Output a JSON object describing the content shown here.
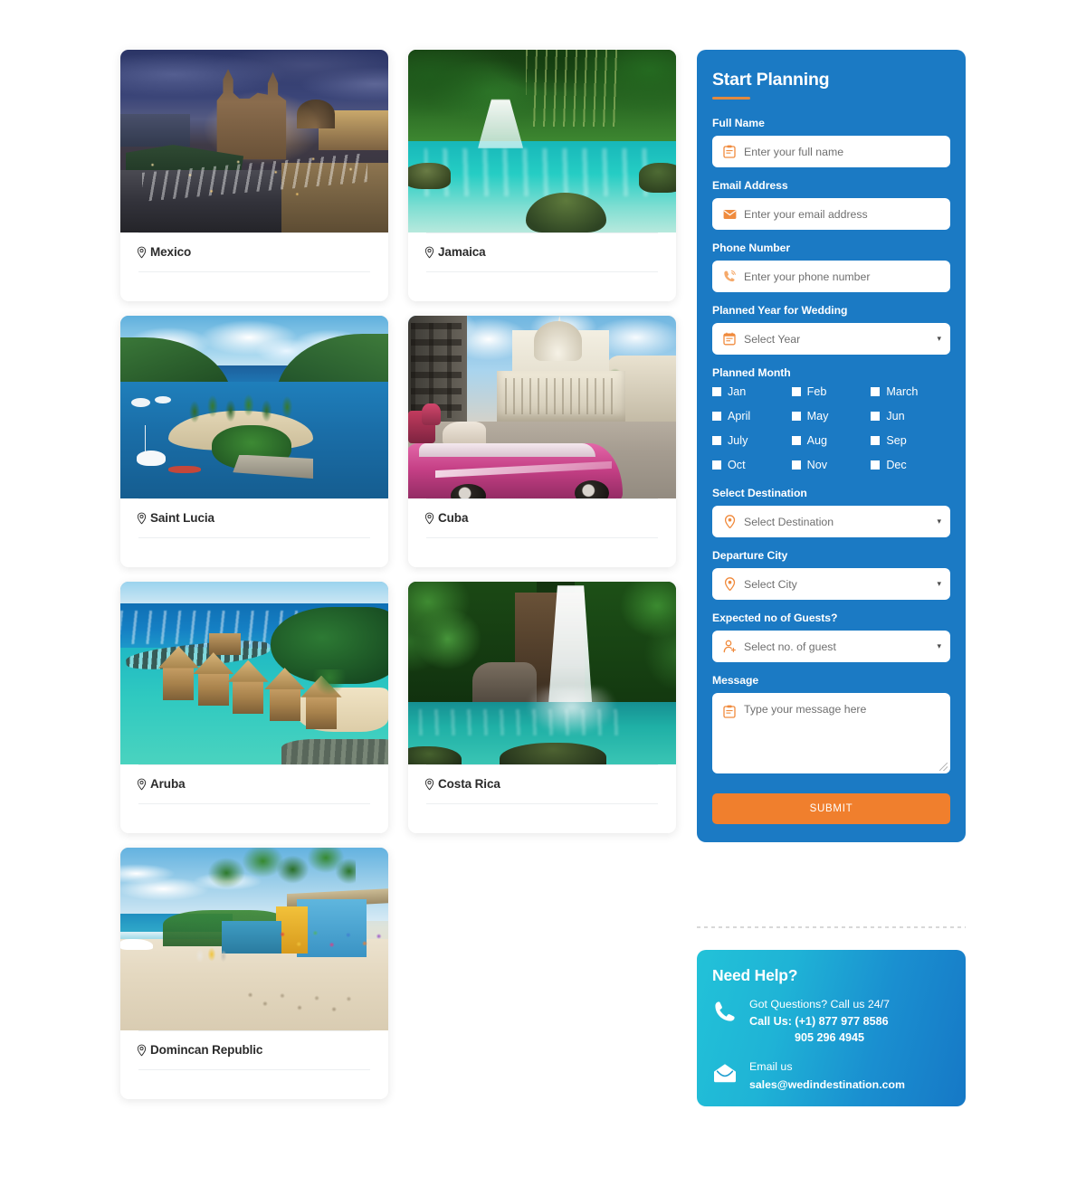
{
  "destinations": [
    {
      "name": "Mexico",
      "icon": "location-pin-icon",
      "art": "art-mexico"
    },
    {
      "name": "Jamaica",
      "icon": "location-pin-icon",
      "art": "art-jamaica"
    },
    {
      "name": "Saint Lucia",
      "icon": "location-pin-icon",
      "art": "art-stlucia"
    },
    {
      "name": "Cuba",
      "icon": "location-pin-icon",
      "art": "art-cuba"
    },
    {
      "name": "Aruba",
      "icon": "location-pin-icon",
      "art": "art-aruba"
    },
    {
      "name": "Costa Rica",
      "icon": "location-pin-icon",
      "art": "art-costarica"
    },
    {
      "name": "Domincan Republic",
      "icon": "location-pin-icon",
      "art": "art-dr"
    }
  ],
  "form": {
    "title": "Start Planning",
    "accent_color": "#e2893f",
    "panel_color": "#1b7ac4",
    "fields": {
      "full_name": {
        "label": "Full Name",
        "placeholder": "Enter your full name",
        "icon": "clipboard-icon"
      },
      "email": {
        "label": "Email Address",
        "placeholder": "Enter your email address",
        "icon": "envelope-icon"
      },
      "phone": {
        "label": "Phone Number",
        "placeholder": "Enter your phone number",
        "icon": "phone-icon"
      },
      "year": {
        "label": "Planned Year for Wedding",
        "placeholder": "Select Year",
        "icon": "calendar-icon"
      },
      "month": {
        "label": "Planned Month"
      },
      "destination": {
        "label": "Select Destination",
        "placeholder": "Select Destination",
        "icon": "map-pin-icon"
      },
      "departure": {
        "label": "Departure City",
        "placeholder": "Select City",
        "icon": "map-pin-icon"
      },
      "guests": {
        "label": "Expected no of Guests?",
        "placeholder": "Select no. of guest",
        "icon": "user-add-icon"
      },
      "message": {
        "label": "Message",
        "placeholder": "Type your message here",
        "icon": "clipboard-icon"
      }
    },
    "months": [
      "Jan",
      "Feb",
      "March",
      "April",
      "May",
      "Jun",
      "July",
      "Aug",
      "Sep",
      "Oct",
      "Nov",
      "Dec"
    ],
    "submit_label": "SUBMIT",
    "submit_color": "#f07f2d"
  },
  "help": {
    "title": "Need Help?",
    "phone_icon": "phone-handset-icon",
    "phone_line1": "Got Questions? Call us 24/7",
    "phone_line2": "Call Us: (+1) 877 977 8586",
    "phone_line3": "905 296 4945",
    "email_icon": "envelope-open-icon",
    "email_line1": "Email us",
    "email_line2": "sales@wedindestination.com"
  }
}
